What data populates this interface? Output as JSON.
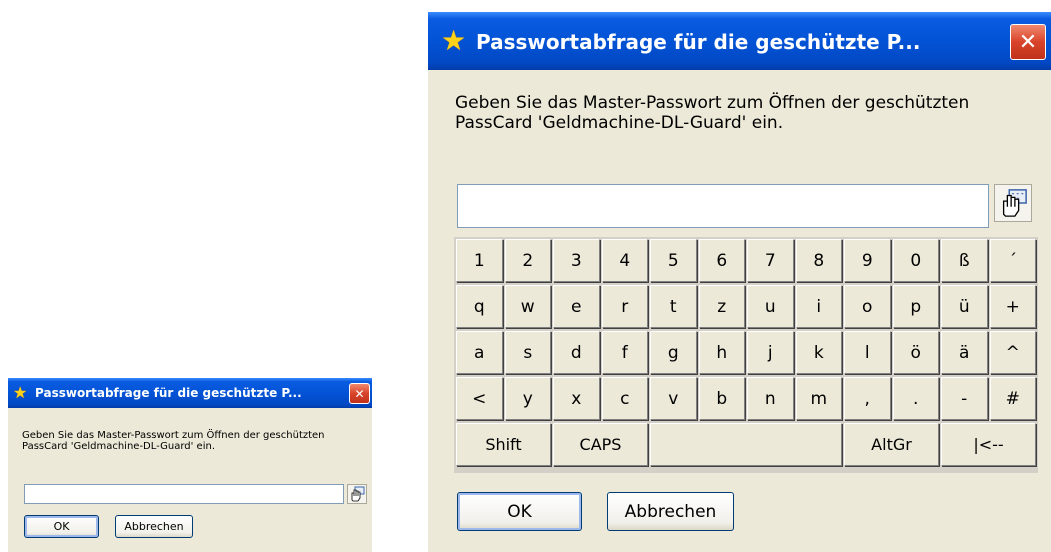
{
  "dialog": {
    "title": "Passwortabfrage für die geschützte P...",
    "message_line1": "Geben Sie das Master-Passwort zum Öffnen der geschützten",
    "message_line2": "PassCard 'Geldmachine-DL-Guard' ein.",
    "password_value": "",
    "ok_label": "OK",
    "cancel_label": "Abbrechen",
    "close_glyph": "✕",
    "title_icon": "star-icon",
    "keyboard_toggle_icon": "virtual-keyboard-hand-icon"
  },
  "keyboard": {
    "rows": [
      [
        "1",
        "2",
        "3",
        "4",
        "5",
        "6",
        "7",
        "8",
        "9",
        "0",
        "ß",
        "´"
      ],
      [
        "q",
        "w",
        "e",
        "r",
        "t",
        "z",
        "u",
        "i",
        "o",
        "p",
        "ü",
        "+"
      ],
      [
        "a",
        "s",
        "d",
        "f",
        "g",
        "h",
        "j",
        "k",
        "l",
        "ö",
        "ä",
        "^"
      ],
      [
        "<",
        "y",
        "x",
        "c",
        "v",
        "b",
        "n",
        "m",
        ",",
        ".",
        "-",
        "#"
      ]
    ],
    "bottom_row": [
      {
        "label": "Shift",
        "name": "key-shift"
      },
      {
        "label": "CAPS",
        "name": "key-caps"
      },
      {
        "label": "",
        "name": "key-space"
      },
      {
        "label": "AltGr",
        "name": "key-altgr"
      },
      {
        "label": "|<--",
        "name": "key-backspace"
      }
    ]
  },
  "colors": {
    "titlebar": "#0353D6",
    "dialog_bg": "#ECE9D8",
    "close_button": "#D8432A",
    "field_border": "#7F9DB9"
  }
}
